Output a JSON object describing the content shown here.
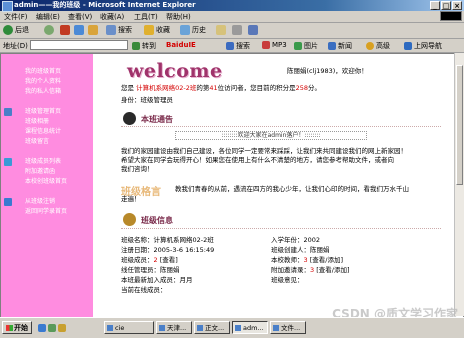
{
  "window": {
    "title": "admin——我的班级 - Microsoft Internet Explorer"
  },
  "menu": [
    "文件(F)",
    "编辑(E)",
    "查看(V)",
    "收藏(A)",
    "工具(T)",
    "帮助(H)"
  ],
  "toolbar": {
    "back": "后退",
    "search": "搜索",
    "favorites": "收藏",
    "history": "历史",
    "ime": "BaiduIE"
  },
  "addressbar": {
    "label": "地址(D)",
    "go": "转到",
    "links": [
      "搜索",
      "MP3",
      "图片",
      "新闻",
      "高级",
      "上网导航"
    ]
  },
  "leftnav": {
    "items": [
      "我的班级首页",
      "我的个人资料",
      "我的私人信箱",
      "班级管理首页",
      "班级相册",
      "课程信息统计",
      "班级留言",
      "班级成员列表",
      "附加邀请函",
      "本校创班级首页",
      "从班级注销",
      "返回同学录首页"
    ]
  },
  "main": {
    "welcome": "welcome",
    "user": "陈丽娟(clj1983)，欢迎你！",
    "visit_prefix": "您是",
    "class_name": "计算机系网络02-2班",
    "visit_mid": "的第",
    "visit_count": "41",
    "visit_suffix": "位访问者，您目前的积分是",
    "points": "258",
    "points_suffix": "分。",
    "identity": "身份：班级管理员",
    "notice_title": "本班通告",
    "notice_marquee": "::::::::欢迎大家在admin落户！::::::::",
    "notice_text1": "我们的家园建设由我们自己建设，各位同学一定要常来踩踩，让我们来共同建设我们的网上新家园！",
    "notice_text2": "希望大家在同学会玩得开心！如果您在使用上有什么不清楚的地方，请您参考帮助文件，或者向",
    "notice_text3": "我们咨询！",
    "slogan_title": "班级格言",
    "slogan_text1": "教我们青春的从前，遇流在四方的我心少年，让我们心印的时间，看我们万水千山",
    "slogan_text2": "走遍！",
    "info_title": "班级信息",
    "info": {
      "name": "班级名称：计算机系网络02-2班",
      "reg_time": "注册日期：2005-3-6  16:15:49",
      "members_label": "班级成员：",
      "members_count": "2",
      "members_link": "[查看]",
      "online_mgr": "线任管理员：陈丽娟",
      "recent_join": "本班最新加入成员：月月",
      "current_online": "当前在线成员：",
      "entry_year": "入学年份：2002",
      "creator": "班级创建人：陈丽娟",
      "photos_label": "本校教师：",
      "photos_count": "3",
      "photos_link": "[查看/添加]",
      "invites_label": "附加邀请录：",
      "invites_count": "3",
      "invites_link": "[查看/添加]",
      "announce": "班级意见："
    }
  },
  "taskbar": {
    "start": "开始",
    "tasks": [
      "cie",
      "天津...",
      "正文...",
      "adm...",
      "文件..."
    ]
  },
  "watermark": "CSDN @质文学习作家"
}
